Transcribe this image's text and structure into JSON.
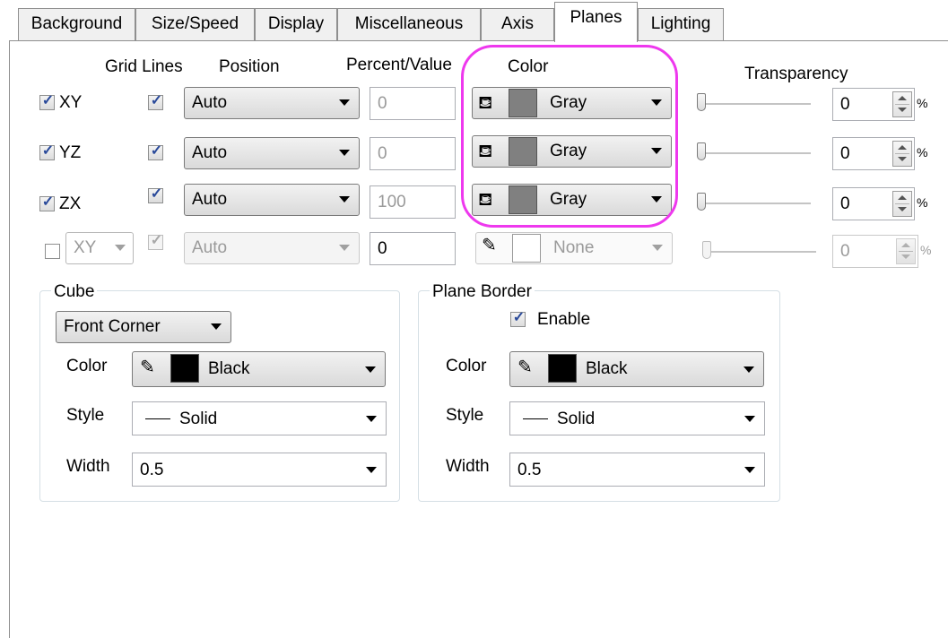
{
  "tabs": [
    "Background",
    "Size/Speed",
    "Display",
    "Miscellaneous",
    "Axis",
    "Planes",
    "Lighting"
  ],
  "active_tab": "Planes",
  "headers": {
    "grid_lines": "Grid Lines",
    "position": "Position",
    "percent_value": "Percent/Value",
    "color": "Color",
    "transparency": "Transparency"
  },
  "rows": [
    {
      "plane": "XY",
      "checked": true,
      "grid": true,
      "position": "Auto",
      "value": "0",
      "color_name": "Gray",
      "color_hex": "#808080",
      "transparency": "0",
      "pct": "%"
    },
    {
      "plane": "YZ",
      "checked": true,
      "grid": true,
      "position": "Auto",
      "value": "0",
      "color_name": "Gray",
      "color_hex": "#808080",
      "transparency": "0",
      "pct": "%"
    },
    {
      "plane": "ZX",
      "checked": true,
      "grid": true,
      "position": "Auto",
      "value": "100",
      "color_name": "Gray",
      "color_hex": "#808080",
      "transparency": "0",
      "pct": "%"
    },
    {
      "plane": "XY",
      "checked": false,
      "grid": true,
      "position": "Auto",
      "value": "0",
      "color_name": "None",
      "color_hex": "#ffffff",
      "transparency": "0",
      "pct": "%"
    }
  ],
  "cube": {
    "title": "Cube",
    "mode": "Front Corner",
    "color_label": "Color",
    "color_value": "Black",
    "style_label": "Style",
    "style_value": "Solid",
    "width_label": "Width",
    "width_value": "0.5"
  },
  "plane_border": {
    "title": "Plane Border",
    "enable_label": "Enable",
    "enabled": true,
    "color_label": "Color",
    "color_value": "Black",
    "style_label": "Style",
    "style_value": "Solid",
    "width_label": "Width",
    "width_value": "0.5"
  },
  "colors": {
    "highlight": "#ee38ee",
    "swatch_black": "#000000",
    "swatch_gray": "#808080",
    "check": "#2a4a9a"
  },
  "icons": {
    "fill_bucket": "paint-bucket-icon",
    "pencil": "pencil-icon"
  }
}
